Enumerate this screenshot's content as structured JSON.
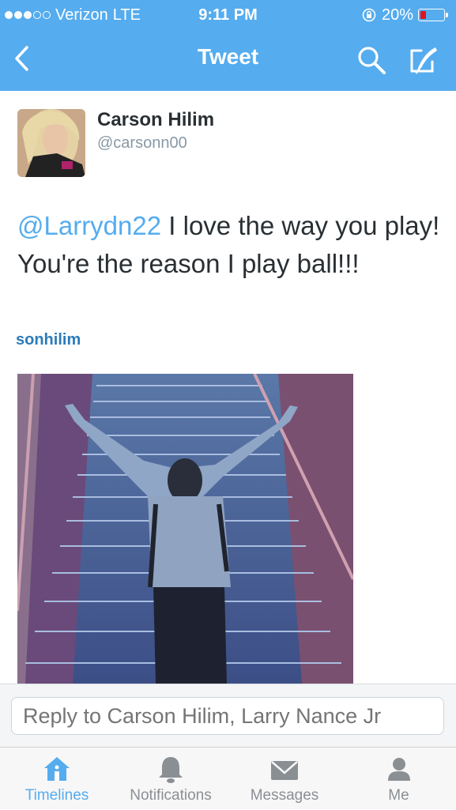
{
  "status_bar": {
    "carrier": "Verizon",
    "network": "LTE",
    "time": "9:11 PM",
    "battery": "20%",
    "signal_bars_filled": 3,
    "signal_bars_total": 5
  },
  "nav": {
    "title": "Tweet",
    "icons": [
      "chevron-left-icon",
      "search-icon",
      "compose-icon"
    ]
  },
  "tweet": {
    "author_name": "Carson Hilim",
    "author_handle": "@carsonn00",
    "mention": "@Larrydn22",
    "text": " I love the way you play! You're the reason I play ball!!!",
    "embedded_user": "sonhilim"
  },
  "reply": {
    "placeholder": "Reply to Carson Hilim, Larry Nance Jr"
  },
  "tabs": [
    {
      "label": "Timelines",
      "icon": "home-icon",
      "active": true
    },
    {
      "label": "Notifications",
      "icon": "bell-icon",
      "active": false
    },
    {
      "label": "Messages",
      "icon": "envelope-icon",
      "active": false
    },
    {
      "label": "Me",
      "icon": "person-icon",
      "active": false
    }
  ],
  "colors": {
    "accent": "#55acee",
    "battery_low": "#e0141d"
  }
}
